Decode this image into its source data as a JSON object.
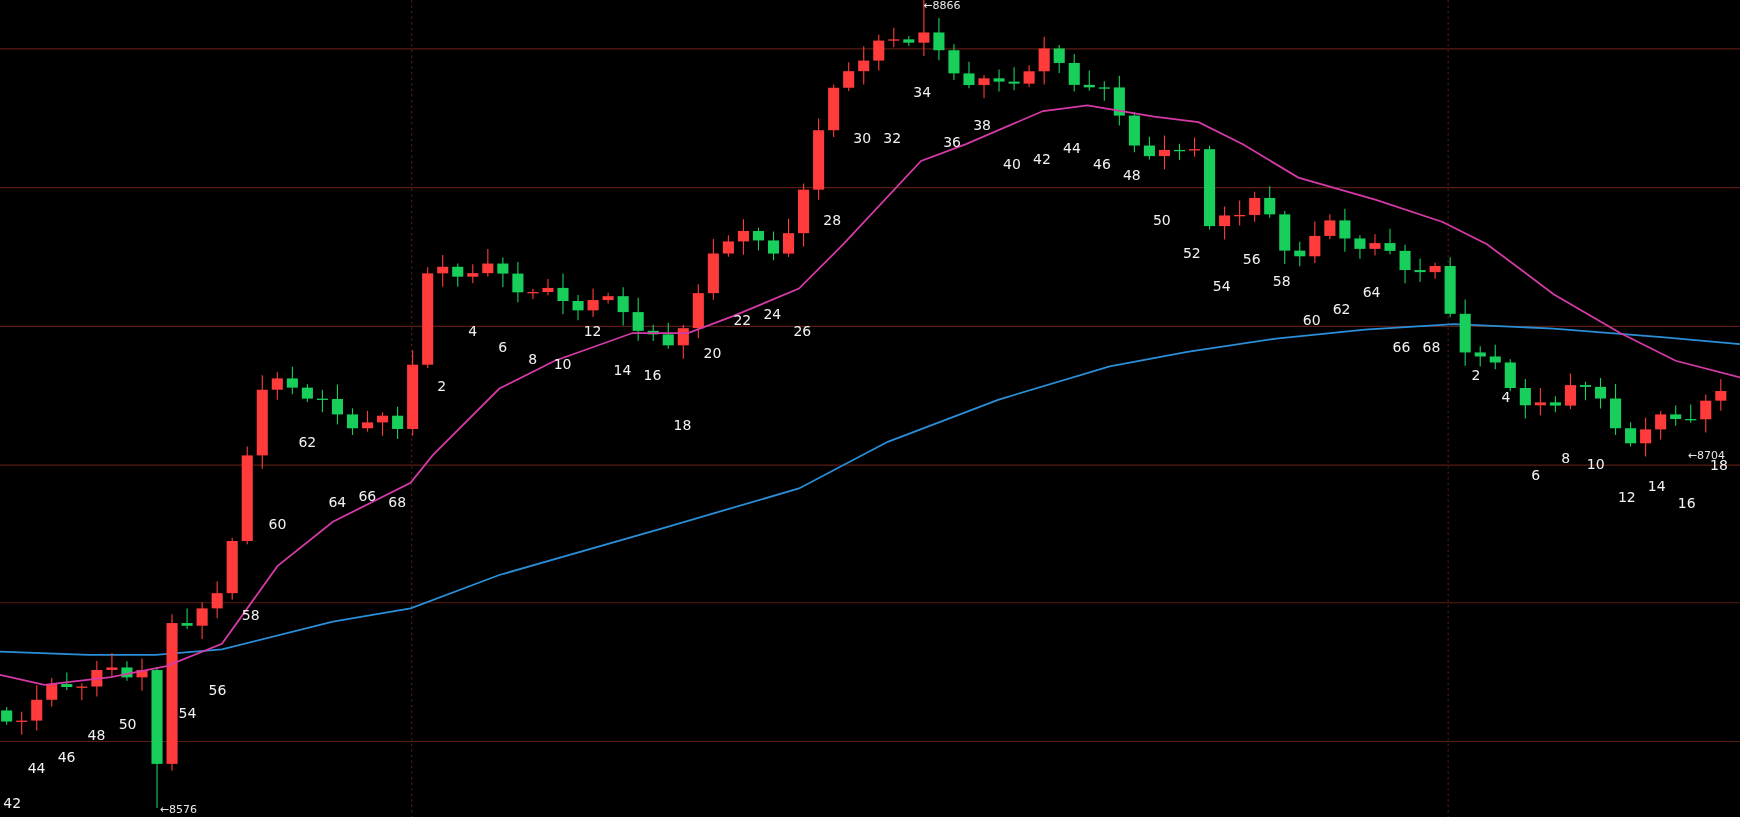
{
  "chart": {
    "bar_labels": [
      {
        "text": "42"
      },
      {
        "text": "44"
      },
      {
        "text": "46"
      },
      {
        "text": "48"
      },
      {
        "text": "50"
      },
      {
        "text": "54"
      },
      {
        "text": "56"
      },
      {
        "text": "58"
      },
      {
        "text": "60"
      },
      {
        "text": "62"
      },
      {
        "text": "64"
      },
      {
        "text": "66"
      },
      {
        "text": "68"
      },
      {
        "text": "2"
      },
      {
        "text": "4"
      },
      {
        "text": "6"
      },
      {
        "text": "8"
      },
      {
        "text": "10"
      },
      {
        "text": "12"
      },
      {
        "text": "14"
      },
      {
        "text": "16"
      },
      {
        "text": "18"
      },
      {
        "text": "20"
      },
      {
        "text": "22"
      },
      {
        "text": "24"
      },
      {
        "text": "26"
      },
      {
        "text": "28"
      },
      {
        "text": "30"
      },
      {
        "text": "32"
      },
      {
        "text": "34"
      },
      {
        "text": "36"
      },
      {
        "text": "38"
      },
      {
        "text": "40"
      },
      {
        "text": "42"
      },
      {
        "text": "44"
      },
      {
        "text": "46"
      },
      {
        "text": "48"
      },
      {
        "text": "50"
      },
      {
        "text": "52"
      },
      {
        "text": "54"
      },
      {
        "text": "56"
      },
      {
        "text": "58"
      },
      {
        "text": "60"
      },
      {
        "text": "62"
      },
      {
        "text": "64"
      },
      {
        "text": "66"
      },
      {
        "text": "68"
      },
      {
        "text": "2"
      },
      {
        "text": "4"
      },
      {
        "text": "6"
      },
      {
        "text": "8"
      },
      {
        "text": "10"
      },
      {
        "text": "12"
      },
      {
        "text": "14"
      },
      {
        "text": "16"
      },
      {
        "text": "18"
      }
    ],
    "price_markers": [
      {
        "text": "←8866"
      },
      {
        "text": "←8576"
      },
      {
        "text": "←8704"
      }
    ]
  }
}
